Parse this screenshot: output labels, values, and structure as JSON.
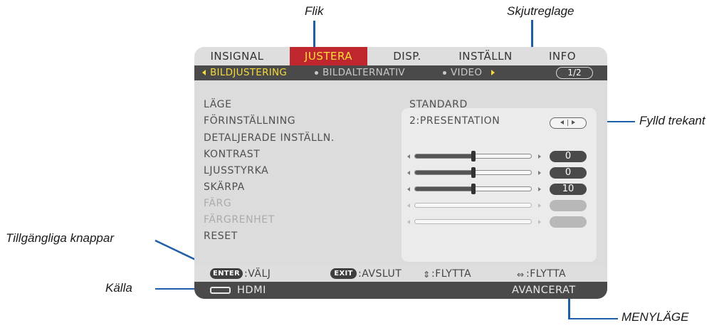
{
  "callouts": {
    "tab": "Flik",
    "slider": "Skjutreglage",
    "filled_triangle": "Fylld trekant",
    "available_buttons": "Tillgängliga knappar",
    "source": "Källa",
    "menu_mode": "MENYLÄGE"
  },
  "menu": {
    "tabs": [
      {
        "label": "INSIGNAL",
        "active": false
      },
      {
        "label": "JUSTERA",
        "active": true
      },
      {
        "label": "DISP.",
        "active": false
      },
      {
        "label": "INSTÄLLN",
        "active": false
      },
      {
        "label": "INFO",
        "active": false
      }
    ],
    "subtabs": [
      {
        "label": "BILDJUSTERING",
        "active": true
      },
      {
        "label": "BILDALTERNATIV",
        "active": false
      },
      {
        "label": "VIDEO",
        "active": false
      }
    ],
    "page": "1/2",
    "rows": [
      {
        "label": "LÄGE",
        "value": "STANDARD",
        "dim": false
      },
      {
        "label": "FÖRINSTÄLLNING",
        "value": "2:PRESENTATION",
        "dim": false
      },
      {
        "label": "DETALJERADE INSTÄLLN.",
        "dim": false
      },
      {
        "label": "KONTRAST",
        "slider_value": "0",
        "slider_level": 0.5,
        "dim": false
      },
      {
        "label": "LJUSSTYRKA",
        "slider_value": "0",
        "slider_level": 0.5,
        "dim": false
      },
      {
        "label": "SKÄRPA",
        "slider_value": "10",
        "slider_level": 0.5,
        "dim": false
      },
      {
        "label": "FÄRG",
        "slider_value": "",
        "dim": true
      },
      {
        "label": "FÄRGRENHET",
        "slider_value": "",
        "dim": true
      },
      {
        "label": "RESET",
        "dim": false
      }
    ],
    "help": [
      {
        "key": "ENTER",
        "action": ":VÄLJ"
      },
      {
        "key": "EXIT",
        "action": ":AVSLUT"
      },
      {
        "key": "⇕",
        "action": ":FLYTTA"
      },
      {
        "key": "⇔",
        "action": ":FLYTTA"
      }
    ],
    "source": {
      "icon": "hdmi-connector-icon",
      "label": "HDMI"
    },
    "mode": "AVANCERAT"
  },
  "colors": {
    "active_tab_bg": "#c0262d",
    "active_tab_text": "#ffde3a",
    "leader_line": "#1e5fa8",
    "subbar_bg": "#4a4a4a"
  }
}
